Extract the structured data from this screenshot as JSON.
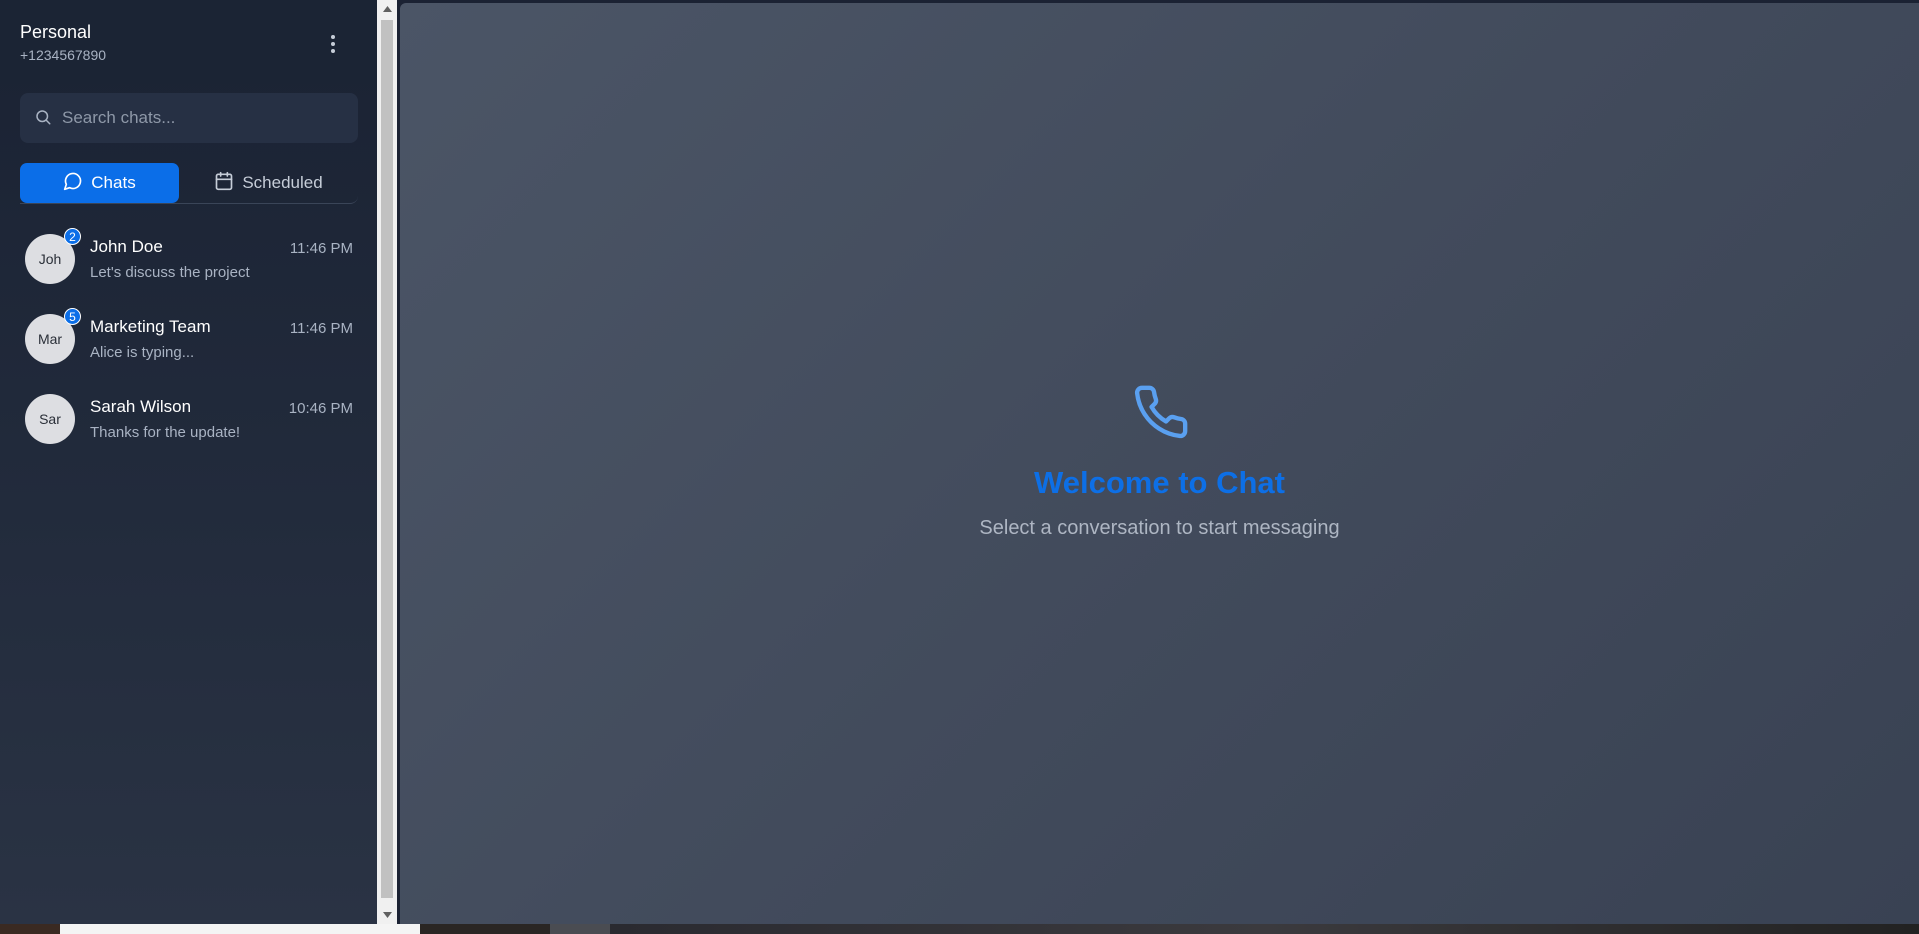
{
  "account": {
    "name": "Personal",
    "phone": "+1234567890",
    "menu_icon": "more-vertical-icon"
  },
  "search": {
    "placeholder": "Search chats...",
    "value": "",
    "icon": "search-icon"
  },
  "tabs": [
    {
      "label": "Chats",
      "icon": "message-circle-icon",
      "active": true
    },
    {
      "label": "Scheduled",
      "icon": "calendar-icon",
      "active": false
    }
  ],
  "chats": [
    {
      "avatar": "Joh",
      "name": "John Doe",
      "time": "11:46 PM",
      "preview": "Let's discuss the project",
      "unread": "2"
    },
    {
      "avatar": "Mar",
      "name": "Marketing Team",
      "time": "11:46 PM",
      "preview": "Alice is typing...",
      "unread": "5"
    },
    {
      "avatar": "Sar",
      "name": "Sarah Wilson",
      "time": "10:46 PM",
      "preview": "Thanks for the update!",
      "unread": null
    }
  ],
  "welcome": {
    "icon": "phone-icon",
    "title": "Welcome to Chat",
    "subtitle": "Select a conversation to start messaging"
  },
  "colors": {
    "accent": "#0b6ee8",
    "sidebar_bg": "#1a2233",
    "main_bg": "#454f60"
  }
}
